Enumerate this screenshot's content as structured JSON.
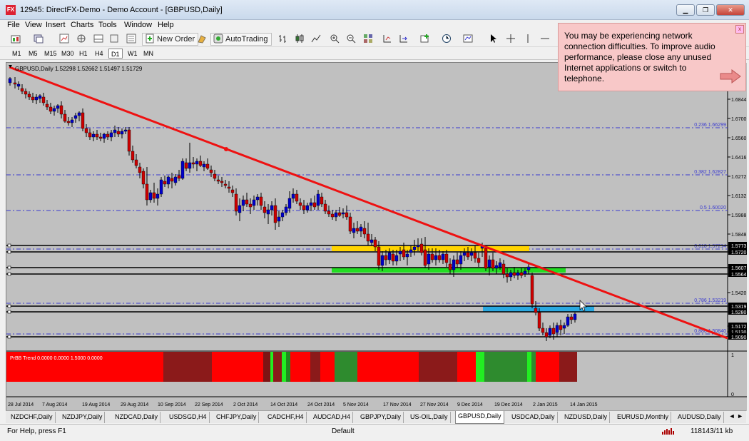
{
  "window": {
    "title": "12945: DirectFX-Demo - Demo Account - [GBPUSD,Daily]",
    "app_icon_text": "FX",
    "minimize_label": "▁",
    "restore_label": "❐",
    "close_label": "✕"
  },
  "menu": {
    "items": [
      "File",
      "View",
      "Insert",
      "Charts",
      "Tools",
      "Window",
      "Help"
    ]
  },
  "toolbar": {
    "new_order_label": "New Order",
    "autotrading_label": "AutoTrading"
  },
  "timeframes": [
    "M1",
    "M5",
    "M15",
    "M30",
    "H1",
    "H4",
    "D1",
    "W1",
    "MN"
  ],
  "active_timeframe": "D1",
  "chart": {
    "header": "GBPUSD,Daily  1.52298 1.52662 1.51497 1.51729",
    "indicator_header": "PrBB Trend 0.0000 0.0000 1.5000 0.0000",
    "price_labels": [
      "1.6844",
      "1.6700",
      "1.6560",
      "1.6416",
      "1.6272",
      "1.6132",
      "1.5988",
      "1.5848",
      "1.5773",
      "1.5720",
      "1.5607",
      "1.5564",
      "1.5420",
      "1.5319",
      "1.5280",
      "1.5172",
      "1.5130",
      "1.5090"
    ],
    "indicator_scale": [
      "1",
      "0"
    ],
    "fib_levels": [
      {
        "label": "0.236  1.66299"
      },
      {
        "label": "0.382  1.62827"
      },
      {
        "label": "0.5  1.60020"
      },
      {
        "label": "0.618  1.57214"
      },
      {
        "label": "0.786  1.53219"
      },
      {
        "label": "0.886  1.50840"
      }
    ],
    "date_labels": [
      "28 Jul 2014",
      "7 Aug 2014",
      "19 Aug 2014",
      "29 Aug 2014",
      "10 Sep 2014",
      "22 Sep 2014",
      "2 Oct 2014",
      "14 Oct 2014",
      "24 Oct 2014",
      "5 Nov 2014",
      "17 Nov 2014",
      "27 Nov 2014",
      "9 Dec 2014",
      "19 Dec 2014",
      "2 Jan 2015",
      "14 Jan 2015"
    ],
    "colors": {
      "background": "#c0c0c0",
      "bull": "#0000cc",
      "bear": "#cc0000",
      "trendline": "#ee1111",
      "fib": "#3a3ad0",
      "zone_yellow": "#ffd400",
      "zone_green": "#22dd22",
      "zone_blue": "#2aa8e0"
    }
  },
  "tabs": {
    "items": [
      "NZDCHF,Daily",
      "NZDJPY,Daily",
      "NZDCAD,Daily",
      "USDSGD,H4",
      "CHFJPY,Daily",
      "CADCHF,H4",
      "AUDCAD,H4",
      "GBPJPY,Daily",
      "US-OIL,Daily",
      "GBPUSD,Daily",
      "USDCAD,Daily",
      "NZDUSD,Daily",
      "EURUSD,Monthly",
      "AUDUSD,Daily"
    ],
    "active": "GBPUSD,Daily",
    "scroll_label": "◄ ►"
  },
  "status": {
    "help": "For Help, press F1",
    "profile": "Default",
    "traffic": "118143/11 kb"
  },
  "notification": {
    "message": "You may be experiencing network connection difficulties. To improve audio performance, please close any unused Internet applications or switch to telephone.",
    "close_label": "x"
  }
}
